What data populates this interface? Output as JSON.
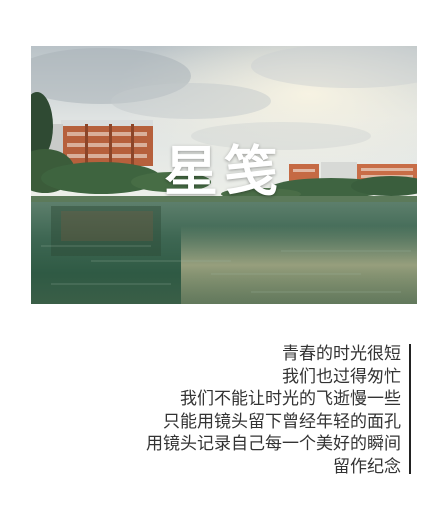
{
  "cover": {
    "title": "星笺"
  },
  "poem": {
    "lines": [
      "青春的时光很短",
      "我们也过得匆忙",
      "我们不能让时光的飞逝慢一些",
      "只能用镜头留下曾经年轻的面孔",
      "用镜头记录自己每一个美好的瞬间",
      "留作纪念"
    ]
  },
  "colors": {
    "background": "#ffffff",
    "text": "#333333",
    "accent_bar": "#222222",
    "title": "#ffffff"
  }
}
